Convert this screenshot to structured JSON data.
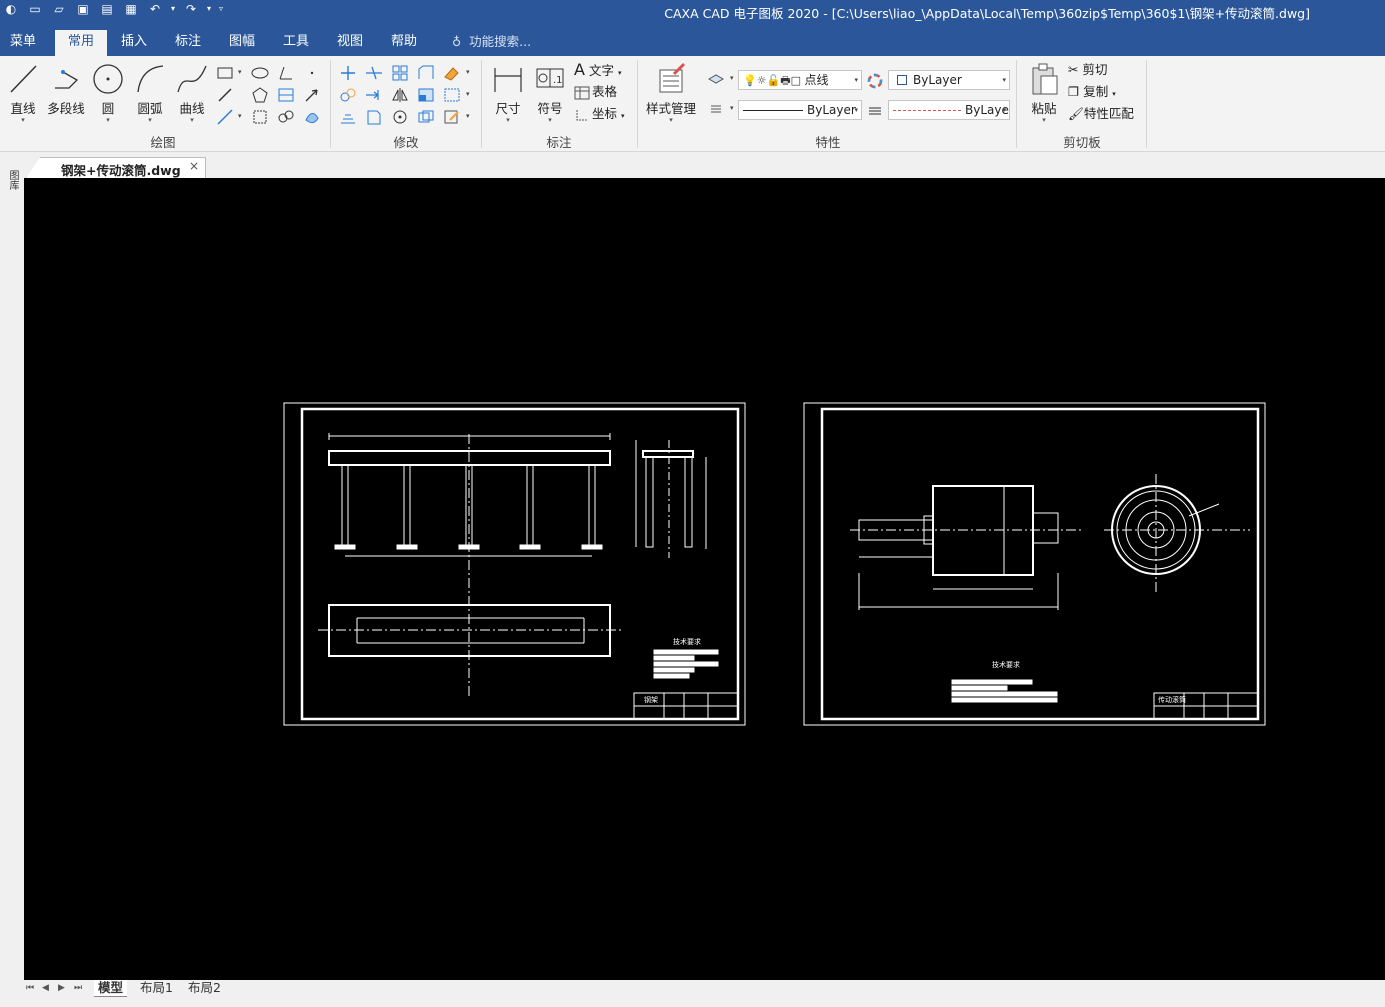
{
  "window": {
    "title": "CAXA CAD 电子图板 2020 - [C:\\Users\\liao_\\AppData\\Local\\Temp\\360zip$Temp\\360$1\\钢架+传动滚筒.dwg]"
  },
  "quick_access": {
    "icons": [
      "app-icon",
      "new-file-icon",
      "open-file-icon",
      "save-icon",
      "save-as-icon",
      "print-icon",
      "undo-icon",
      "redo-icon",
      "customize-icon"
    ]
  },
  "menu": {
    "tabs": [
      {
        "label": "菜单",
        "active": false
      },
      {
        "label": "常用",
        "active": true
      },
      {
        "label": "插入",
        "active": false
      },
      {
        "label": "标注",
        "active": false
      },
      {
        "label": "图幅",
        "active": false
      },
      {
        "label": "工具",
        "active": false
      },
      {
        "label": "视图",
        "active": false
      },
      {
        "label": "帮助",
        "active": false
      }
    ],
    "search_placeholder": "功能搜索..."
  },
  "ribbon": {
    "draw": {
      "label": "绘图",
      "line": "直线",
      "polyline": "多段线",
      "circle": "圆",
      "arc": "圆弧",
      "curve": "曲线"
    },
    "modify": {
      "label": "修改"
    },
    "annotate": {
      "label": "标注",
      "dimension": "尺寸",
      "symbol": "符号",
      "text": "文字",
      "table": "表格",
      "coordinate": "坐标"
    },
    "properties": {
      "label": "特性",
      "style_manager": "样式管理",
      "layer_value": "点线",
      "color_value": "ByLayer",
      "linetype_value": "ByLayer",
      "lineweight_value": "ByLaye"
    },
    "clipboard": {
      "label": "剪切板",
      "paste": "粘贴",
      "cut": "剪切",
      "copy": "复制",
      "match_props": "特性匹配"
    }
  },
  "document": {
    "tab_label": "钢架+传动滚筒.dwg",
    "close_glyph": "×",
    "side_panel_label": "图库"
  },
  "drawing": {
    "sheet1_title_tag": "钢架",
    "sheet1_notes_title": "技术要求",
    "sheet2_title_tag": "传动滚筒",
    "sheet2_notes_title": "技术要求"
  },
  "layout_tabs": {
    "nav": [
      "⏮",
      "◀",
      "▶",
      "⏭"
    ],
    "tabs": [
      {
        "label": "模型",
        "active": true
      },
      {
        "label": "布局1",
        "active": false
      },
      {
        "label": "布局2",
        "active": false
      }
    ]
  },
  "colors": {
    "titlebar": "#2b579a",
    "ribbon_bg": "#f3f3f3",
    "canvas_bg": "#000000",
    "drawing_lines": "#ffffff"
  }
}
